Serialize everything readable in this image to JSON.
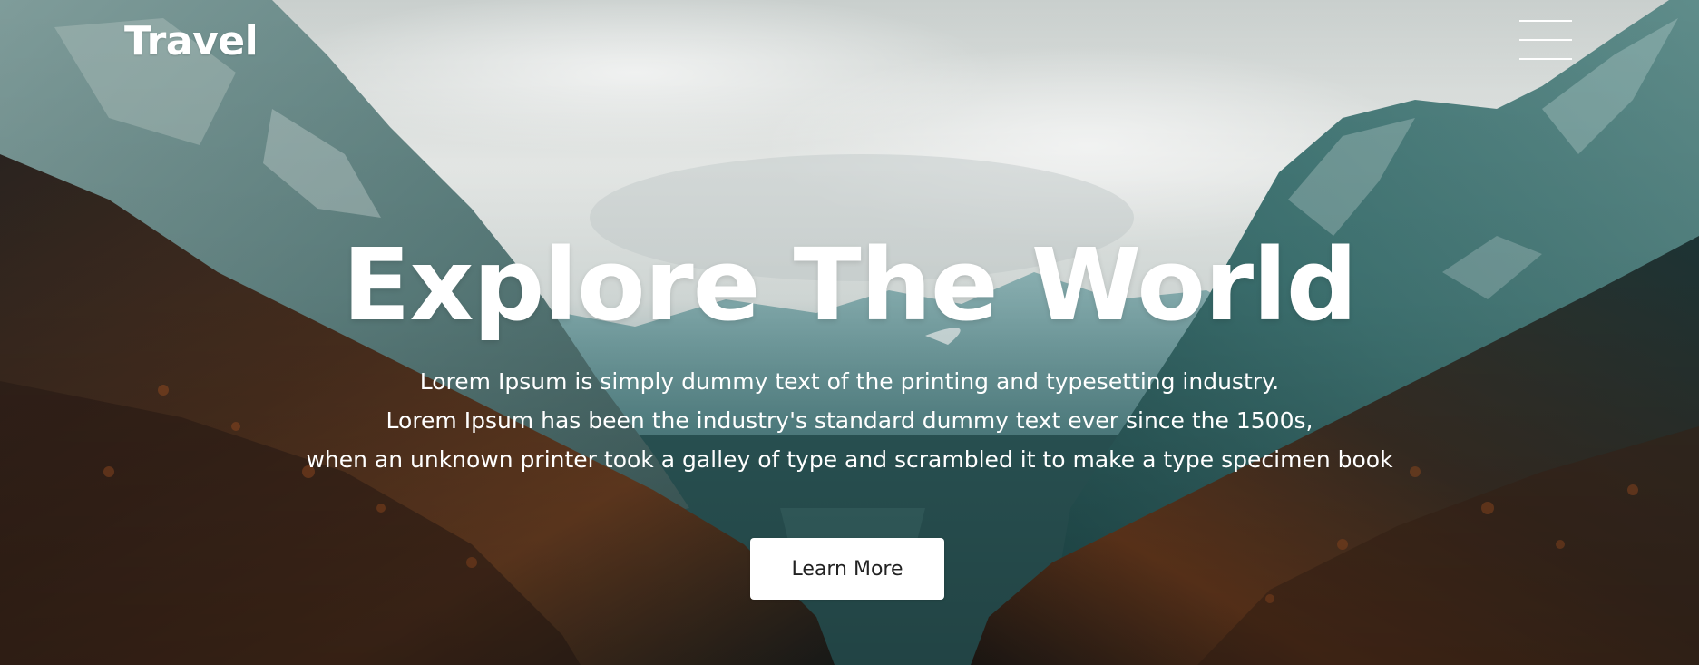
{
  "header": {
    "logo_text": "Travel",
    "menu_icon": "hamburger-menu-icon"
  },
  "hero": {
    "title": "Explore The World",
    "paragraph_lines": [
      "Lorem Ipsum is simply dummy text of the printing and typesetting industry.",
      "Lorem Ipsum has been the industry's standard dummy text ever since the 1500s,",
      "when an unknown printer took a galley of type and scrambled it to make a type specimen book"
    ],
    "button_label": "Learn More"
  },
  "colors": {
    "text": "#ffffff",
    "button_bg": "#ffffff",
    "button_text": "#222222"
  }
}
